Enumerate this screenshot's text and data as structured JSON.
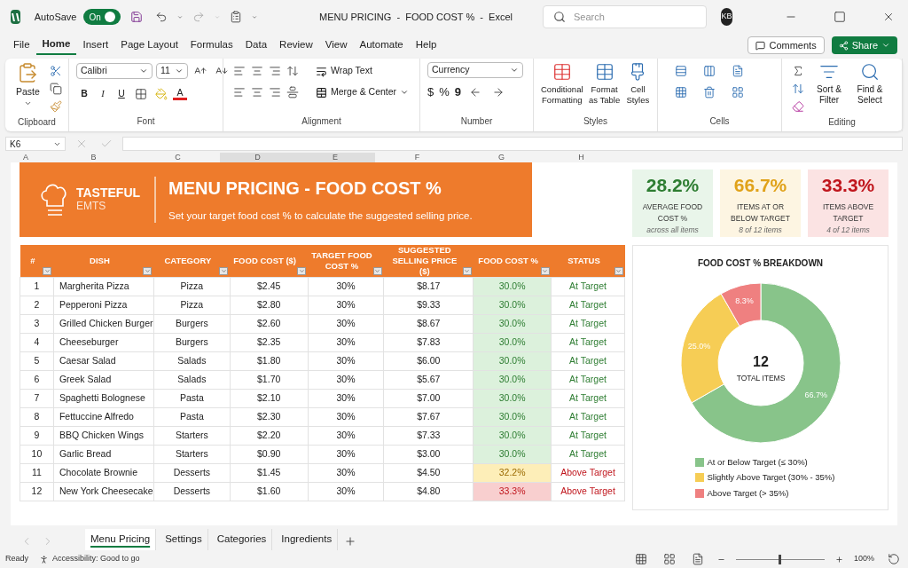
{
  "titlebar": {
    "app": "AutoSave",
    "autosave": {
      "label": "On",
      "on": true
    },
    "title": "MENU PRICING  -  FOOD COST %  -  Excel",
    "search": {
      "placeholder": "Search"
    },
    "avatar": "KB"
  },
  "menu": [
    {
      "label": "File",
      "selected": false
    },
    {
      "label": "Home",
      "selected": true
    },
    {
      "label": "Insert",
      "selected": false
    },
    {
      "label": "Page Layout",
      "selected": false
    },
    {
      "label": "Formulas",
      "selected": false
    },
    {
      "label": "Data",
      "selected": false
    },
    {
      "label": "Review",
      "selected": false
    },
    {
      "label": "View",
      "selected": false
    },
    {
      "label": "Automate",
      "selected": false
    },
    {
      "label": "Help",
      "selected": false
    }
  ],
  "menu_buttons": {
    "comments": "Comments",
    "share": "Share"
  },
  "ribbon": {
    "clipboard": {
      "label": "Clipboard",
      "paste": "Paste"
    },
    "font": {
      "label": "Font",
      "family": "Calibri",
      "size": "11",
      "bold": "B",
      "italic": "I",
      "underline": "U",
      "color_letter": "A"
    },
    "alignment": {
      "label": "Alignment",
      "wrap": "Wrap Text",
      "merge": "Merge & Center"
    },
    "number": {
      "label": "Number",
      "format": "Currency",
      "currency": "$",
      "percent": "%",
      "comma": "9"
    },
    "styles": {
      "label": "Styles",
      "buttons": [
        "Conditional Formatting",
        "Format as Table",
        "Cell Styles"
      ]
    },
    "cells": {
      "label": "Cells"
    },
    "editing": {
      "label": "Editing",
      "buttons": [
        "Sort & Filter",
        "Find & Select"
      ]
    }
  },
  "formula_bar": {
    "name_box": "K6"
  },
  "columns": [
    {
      "label": "A",
      "selected": false
    },
    {
      "label": "B",
      "selected": false
    },
    {
      "label": "C",
      "selected": false
    },
    {
      "label": "D",
      "selected": true
    },
    {
      "label": "E",
      "selected": true
    },
    {
      "label": "F",
      "selected": false
    },
    {
      "label": "G",
      "selected": false
    },
    {
      "label": "H",
      "selected": false
    }
  ],
  "banner": {
    "brand": [
      "TASTEFUL",
      "EMTS"
    ],
    "title": "MENU PRICING - FOOD COST %",
    "subtitle": "Set your target food cost % to calculate the suggested selling price."
  },
  "kpis": [
    {
      "value": "28.2%",
      "label": "AVERAGE FOOD COST %",
      "note": "across all items",
      "kind": "good"
    },
    {
      "value": "66.7%",
      "label": "ITEMS AT OR BELOW TARGET",
      "note": "8 of 12 items",
      "kind": "warn"
    },
    {
      "value": "33.3%",
      "label": "ITEMS ABOVE TARGET",
      "note": "4 of 12 items",
      "kind": "bad"
    }
  ],
  "table": {
    "columns": [
      "#",
      "DISH",
      "CATEGORY",
      "FOOD COST ($)",
      "TARGET FOOD COST %",
      "SUGGESTED SELLING PRICE ($)",
      "FOOD COST %",
      "STATUS"
    ],
    "rows": [
      {
        "cells": [
          "1",
          "Margherita Pizza",
          "Pizza",
          "$2.45",
          "30%",
          "$8.17",
          "30.0%",
          "At Target"
        ],
        "kind": "ok"
      },
      {
        "cells": [
          "2",
          "Pepperoni Pizza",
          "Pizza",
          "$2.80",
          "30%",
          "$9.33",
          "30.0%",
          "At Target"
        ],
        "kind": "ok"
      },
      {
        "cells": [
          "3",
          "Grilled Chicken Burger",
          "Burgers",
          "$2.60",
          "30%",
          "$8.67",
          "30.0%",
          "At Target"
        ],
        "kind": "ok"
      },
      {
        "cells": [
          "4",
          "Cheeseburger",
          "Burgers",
          "$2.35",
          "30%",
          "$7.83",
          "30.0%",
          "At Target"
        ],
        "kind": "ok"
      },
      {
        "cells": [
          "5",
          "Caesar Salad",
          "Salads",
          "$1.80",
          "30%",
          "$6.00",
          "30.0%",
          "At Target"
        ],
        "kind": "ok"
      },
      {
        "cells": [
          "6",
          "Greek Salad",
          "Salads",
          "$1.70",
          "30%",
          "$5.67",
          "30.0%",
          "At Target"
        ],
        "kind": "ok"
      },
      {
        "cells": [
          "7",
          "Spaghetti Bolognese",
          "Pasta",
          "$2.10",
          "30%",
          "$7.00",
          "30.0%",
          "At Target"
        ],
        "kind": "ok"
      },
      {
        "cells": [
          "8",
          "Fettuccine Alfredo",
          "Pasta",
          "$2.30",
          "30%",
          "$7.67",
          "30.0%",
          "At Target"
        ],
        "kind": "ok"
      },
      {
        "cells": [
          "9",
          "BBQ Chicken Wings",
          "Starters",
          "$2.20",
          "30%",
          "$7.33",
          "30.0%",
          "At Target"
        ],
        "kind": "ok"
      },
      {
        "cells": [
          "10",
          "Garlic Bread",
          "Starters",
          "$0.90",
          "30%",
          "$3.00",
          "30.0%",
          "At Target"
        ],
        "kind": "ok"
      },
      {
        "cells": [
          "11",
          "Chocolate Brownie",
          "Desserts",
          "$1.45",
          "30%",
          "$4.50",
          "32.2%",
          "Above Target"
        ],
        "kind": "warn"
      },
      {
        "cells": [
          "12",
          "New York Cheesecake",
          "Desserts",
          "$1.60",
          "30%",
          "$4.80",
          "33.3%",
          "Above Target"
        ],
        "kind": "bad"
      }
    ]
  },
  "chart": {
    "center_value": "12",
    "center_label": "TOTAL ITEMS",
    "chart_data": {
      "type": "donut",
      "title": "FOOD COST % BREAKDOWN",
      "categories": [
        "At or Below Target (≤ 30%)",
        "Slightly Above Target (30% - 35%)",
        "Above Target (> 35%)"
      ],
      "values": [
        66.7,
        25.0,
        8.3
      ],
      "value_labels": [
        "66.7%",
        "25.0%",
        "8.3%"
      ],
      "legend": "bottom"
    },
    "slices": [
      {
        "color": "#88c48a"
      },
      {
        "color": "#f6cd55"
      },
      {
        "color": "#ef8080"
      }
    ]
  },
  "sheets": [
    {
      "label": "Menu Pricing",
      "selected": true
    },
    {
      "label": "Settings",
      "selected": false
    },
    {
      "label": "Categories",
      "selected": false
    },
    {
      "label": "Ingredients",
      "selected": false
    }
  ],
  "status": {
    "ready": "Ready",
    "accessibility": "Accessibility: Good to go",
    "zoom": {
      "level": 0.5,
      "reading": "100%"
    }
  }
}
